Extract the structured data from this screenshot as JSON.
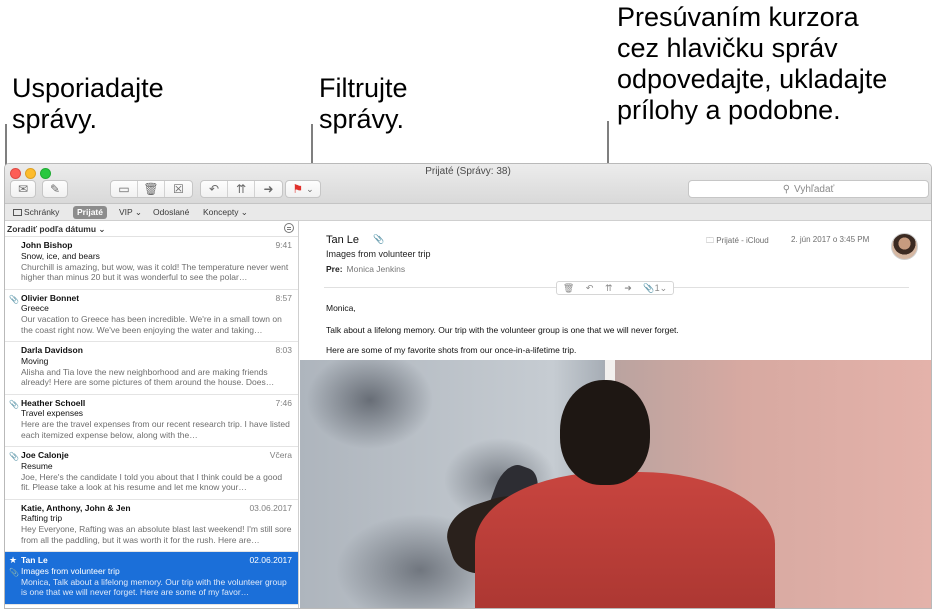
{
  "callouts": {
    "sort": "Usporiadajte\nsprávy.",
    "filter": "Filtrujte\nsprávy.",
    "header": "Presúvaním kurzora\ncez hlavičku správ\nodpovedajte, ukladajte\nprílohy a podobne."
  },
  "window": {
    "title": "Prijaté (Správy: 38)"
  },
  "search": {
    "placeholder": "Vyhľadať"
  },
  "favorites": {
    "mailboxes": "Schránky",
    "inbox": "Prijaté",
    "vip": "VIP ⌄",
    "sent": "Odoslané",
    "drafts": "Koncepty ⌄"
  },
  "list": {
    "sort_label": "Zoradiť podľa dátumu ⌄",
    "messages": [
      {
        "from": "John Bishop",
        "date": "9:41",
        "subject": "Snow, ice, and bears",
        "preview": "Churchill is amazing, but wow, was it cold! The temperature never went higher than minus 20 but it was wonderful to see the polar…",
        "attachment": false
      },
      {
        "from": "Olivier Bonnet",
        "date": "8:57",
        "subject": "Greece",
        "preview": "Our vacation to Greece has been incredible. We're in a small town on the coast right now. We've been enjoying the water and taking…",
        "attachment": true
      },
      {
        "from": "Darla Davidson",
        "date": "8:03",
        "subject": "Moving",
        "preview": "Alisha and Tia love the new neighborhood and are making friends already! Here are some pictures of them around the house. Does…",
        "attachment": false
      },
      {
        "from": "Heather Schoell",
        "date": "7:46",
        "subject": "Travel expenses",
        "preview": "Here are the travel expenses from our recent research trip. I have listed each itemized expense below, along with the…",
        "attachment": true
      },
      {
        "from": "Joe Calonje",
        "date": "Včera",
        "subject": "Resume",
        "preview": "Joe, Here's the candidate I told you about that I think could be a good fit. Please take a look at his resume and let me know your…",
        "attachment": true
      },
      {
        "from": "Katie, Anthony, John & Jen",
        "date": "03.06.2017",
        "subject": "Rafting trip",
        "preview": "Hey Everyone, Rafting was an absolute blast last weekend! I'm still sore from all the paddling, but it was worth it for the rush. Here are…",
        "attachment": false
      },
      {
        "from": "Tan Le",
        "date": "02.06.2017",
        "subject": "Images from volunteer trip",
        "preview": "Monica, Talk about a lifelong memory. Our trip with the volunteer group is one that we will never forget. Here are some of my favor…",
        "attachment": true
      }
    ]
  },
  "reader": {
    "from": "Tan Le",
    "subject": "Images from volunteer trip",
    "to_label": "Pre:",
    "to_value": "Monica Jenkins",
    "mailbox": "Prijaté - iCloud",
    "date": "2. jún 2017 o 3:45 PM",
    "attachments_count": "1",
    "body": [
      "Monica,",
      "Talk about a lifelong memory. Our trip with the volunteer group is one that we will never forget.",
      "Here are some of my favorite shots from our once-in-a-lifetime trip."
    ]
  },
  "colors": {
    "selection": "#1b6fd9",
    "flag": "#e0302b"
  }
}
